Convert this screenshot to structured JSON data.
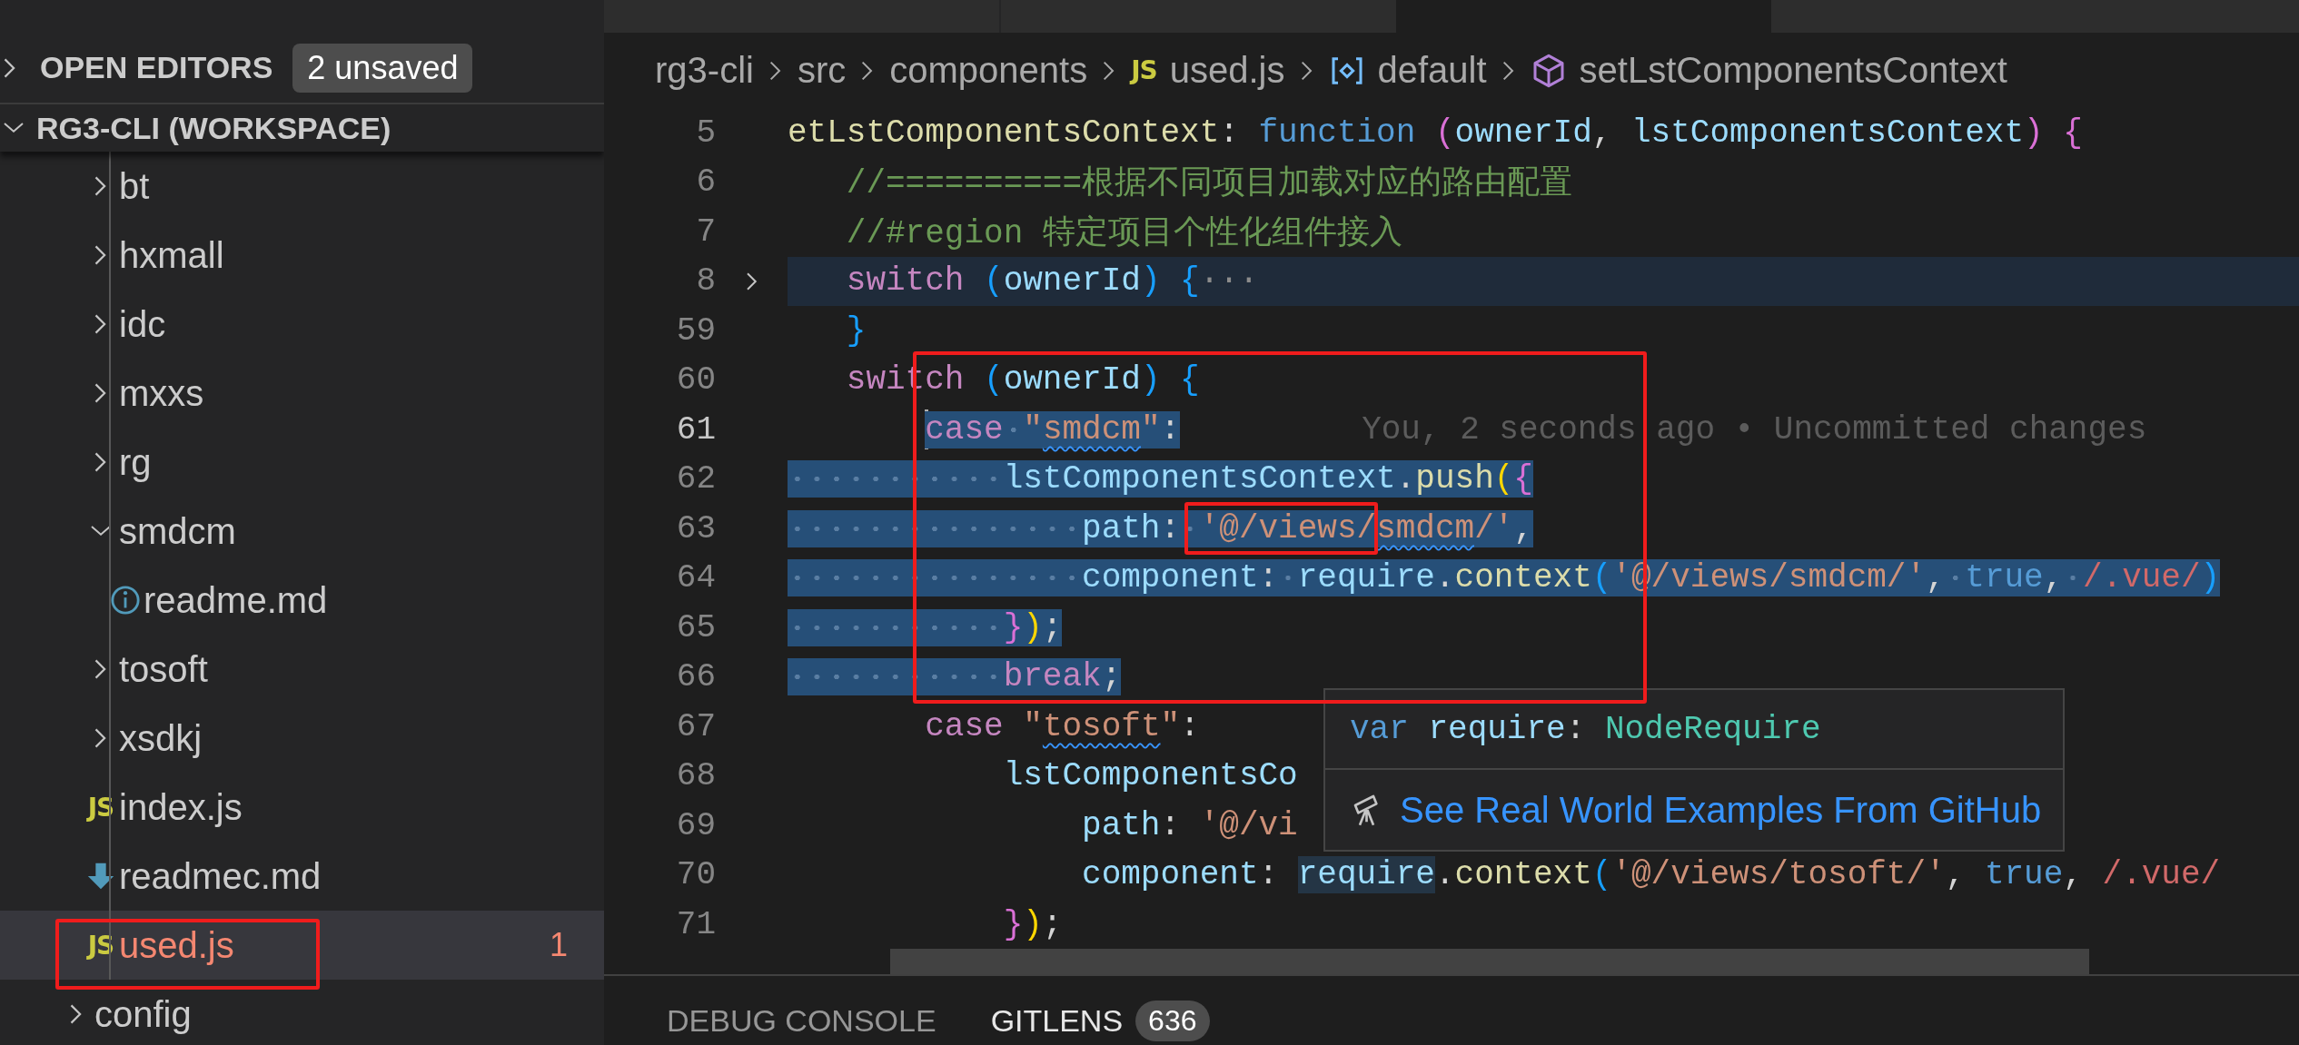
{
  "sidebar": {
    "open_editors": {
      "title": "OPEN EDITORS",
      "badge": "2 unsaved",
      "expanded": false
    },
    "workspace": {
      "title": "RG3-CLI (WORKSPACE)",
      "expanded": true
    },
    "items": [
      {
        "label": "bt",
        "kind": "folder",
        "expanded": false,
        "selected": false,
        "modified": false
      },
      {
        "label": "hxmall",
        "kind": "folder",
        "expanded": false,
        "selected": false,
        "modified": false
      },
      {
        "label": "idc",
        "kind": "folder",
        "expanded": false,
        "selected": false,
        "modified": false
      },
      {
        "label": "mxxs",
        "kind": "folder",
        "expanded": false,
        "selected": false,
        "modified": false
      },
      {
        "label": "rg",
        "kind": "folder",
        "expanded": false,
        "selected": false,
        "modified": false
      },
      {
        "label": "smdcm",
        "kind": "folder",
        "expanded": true,
        "selected": false,
        "modified": false,
        "children": [
          {
            "label": "readme.md",
            "kind": "info",
            "selected": false,
            "modified": false
          }
        ]
      },
      {
        "label": "tosoft",
        "kind": "folder",
        "expanded": false,
        "selected": false,
        "modified": false
      },
      {
        "label": "xsdkj",
        "kind": "folder",
        "expanded": false,
        "selected": false,
        "modified": false
      },
      {
        "label": "index.js",
        "kind": "js",
        "icon_label": "JS",
        "selected": false,
        "modified": false
      },
      {
        "label": "readmec.md",
        "kind": "download",
        "selected": false,
        "modified": false
      },
      {
        "label": "used.js",
        "kind": "js",
        "icon_label": "JS",
        "selected": true,
        "modified": true,
        "problems": "1"
      }
    ],
    "parent_items": [
      {
        "label": "config",
        "kind": "folder",
        "expanded": false,
        "selected": false,
        "modified": false
      }
    ]
  },
  "breadcrumb": [
    {
      "label": "rg3-cli",
      "kind": "plain"
    },
    {
      "label": "src",
      "kind": "plain"
    },
    {
      "label": "components",
      "kind": "plain"
    },
    {
      "label": "used.js",
      "kind": "js",
      "icon_label": "JS"
    },
    {
      "label": "default",
      "kind": "module"
    },
    {
      "label": "setLstComponentsContext",
      "kind": "method"
    }
  ],
  "editor": {
    "lines": [
      {
        "number": "5",
        "selected": false,
        "current": false,
        "folded": false,
        "tokens": [
          {
            "text": "etLstComponentsContext",
            "kind": "fn"
          },
          {
            "text": ": ",
            "kind": "punc"
          },
          {
            "text": "function",
            "kind": "storage"
          },
          {
            "text": " (",
            "kind": "b2"
          },
          {
            "text": "ownerId",
            "kind": "id"
          },
          {
            "text": ", ",
            "kind": "punc"
          },
          {
            "text": "lstComponentsContext",
            "kind": "id"
          },
          {
            "text": ")",
            "kind": "b2"
          },
          {
            "text": " {",
            "kind": "b2"
          }
        ]
      },
      {
        "number": "6",
        "selected": false,
        "current": false,
        "folded": false,
        "tokens": [
          {
            "text": "   //==========根据不同项目加载对应的路由配置",
            "kind": "com"
          }
        ]
      },
      {
        "number": "7",
        "selected": false,
        "current": false,
        "folded": false,
        "tokens": [
          {
            "text": "   //#region 特定项目个性化组件接入",
            "kind": "com"
          }
        ]
      },
      {
        "number": "8",
        "selected": false,
        "current": false,
        "folded": true,
        "tokens": [
          {
            "text": "   switch",
            "kind": "kw"
          },
          {
            "text": " (",
            "kind": "b1"
          },
          {
            "text": "ownerId",
            "kind": "id"
          },
          {
            "text": ")",
            "kind": "b1"
          },
          {
            "text": " {",
            "kind": "b1"
          },
          {
            "text": "···",
            "kind": "fold"
          }
        ]
      },
      {
        "number": "59",
        "selected": false,
        "current": false,
        "folded": false,
        "tokens": [
          {
            "text": "   }",
            "kind": "b1"
          }
        ]
      },
      {
        "number": "60",
        "selected": false,
        "current": false,
        "folded": false,
        "tokens": [
          {
            "text": "   switch",
            "kind": "kw"
          },
          {
            "text": " (",
            "kind": "b1"
          },
          {
            "text": "ownerId",
            "kind": "id"
          },
          {
            "text": ")",
            "kind": "b1"
          },
          {
            "text": " {",
            "kind": "b1"
          }
        ]
      },
      {
        "number": "61",
        "selected": true,
        "current": true,
        "folded": false,
        "blame": "You, 2 seconds ago • Uncommitted changes",
        "tokens": [
          {
            "text": "       case",
            "kind": "kw"
          },
          {
            "text": " \"",
            "kind": "str"
          },
          {
            "text": "smdcm",
            "kind": "spell"
          },
          {
            "text": "\"",
            "kind": "str"
          },
          {
            "text": ":",
            "kind": "punc"
          }
        ]
      },
      {
        "number": "62",
        "selected": true,
        "current": false,
        "folded": false,
        "tokens": [
          {
            "text": "           lstComponentsContext",
            "kind": "id"
          },
          {
            "text": ".",
            "kind": "punc"
          },
          {
            "text": "push",
            "kind": "fn"
          },
          {
            "text": "(",
            "kind": "b3"
          },
          {
            "text": "{",
            "kind": "b2"
          }
        ]
      },
      {
        "number": "63",
        "selected": true,
        "current": false,
        "folded": false,
        "tokens": [
          {
            "text": "               path",
            "kind": "id"
          },
          {
            "text": ":",
            "kind": "punc"
          },
          {
            "text": " '@/views/",
            "kind": "str"
          },
          {
            "text": "smdcm",
            "kind": "spell"
          },
          {
            "text": "/'",
            "kind": "str"
          },
          {
            "text": ",",
            "kind": "punc"
          }
        ]
      },
      {
        "number": "64",
        "selected": true,
        "current": false,
        "folded": false,
        "tokens": [
          {
            "text": "               component",
            "kind": "id"
          },
          {
            "text": ":",
            "kind": "punc"
          },
          {
            "text": " require",
            "kind": "id"
          },
          {
            "text": ".",
            "kind": "punc"
          },
          {
            "text": "context",
            "kind": "fn"
          },
          {
            "text": "(",
            "kind": "b1"
          },
          {
            "text": "'@/views/smdcm/'",
            "kind": "str"
          },
          {
            "text": ",",
            "kind": "punc"
          },
          {
            "text": " true",
            "kind": "storage"
          },
          {
            "text": ",",
            "kind": "punc"
          },
          {
            "text": " /.vue/",
            "kind": "rx"
          },
          {
            "text": ")",
            "kind": "b1"
          }
        ]
      },
      {
        "number": "65",
        "selected": true,
        "current": false,
        "folded": false,
        "tokens": [
          {
            "text": "           }",
            "kind": "b2"
          },
          {
            "text": ")",
            "kind": "b3"
          },
          {
            "text": ";",
            "kind": "punc"
          }
        ]
      },
      {
        "number": "66",
        "selected": true,
        "current": false,
        "folded": false,
        "tokens": [
          {
            "text": "           break",
            "kind": "kw"
          },
          {
            "text": ";",
            "kind": "punc"
          }
        ]
      },
      {
        "number": "67",
        "selected": false,
        "current": false,
        "folded": false,
        "tokens": [
          {
            "text": "       case",
            "kind": "kw"
          },
          {
            "text": " \"",
            "kind": "str"
          },
          {
            "text": "tosoft",
            "kind": "spell"
          },
          {
            "text": "\"",
            "kind": "str"
          },
          {
            "text": ":",
            "kind": "punc"
          }
        ]
      },
      {
        "number": "68",
        "selected": false,
        "current": false,
        "folded": false,
        "tokens": [
          {
            "text": "           lstComponentsCo",
            "kind": "id"
          }
        ]
      },
      {
        "number": "69",
        "selected": false,
        "current": false,
        "folded": false,
        "tokens": [
          {
            "text": "               path",
            "kind": "id"
          },
          {
            "text": ": ",
            "kind": "punc"
          },
          {
            "text": "'@/vi",
            "kind": "str"
          }
        ]
      },
      {
        "number": "70",
        "selected": false,
        "current": false,
        "folded": false,
        "tokens": [
          {
            "text": "               component",
            "kind": "id"
          },
          {
            "text": ": ",
            "kind": "punc"
          },
          {
            "text": "require",
            "kind": "hl"
          },
          {
            "text": ".",
            "kind": "punc"
          },
          {
            "text": "context",
            "kind": "fn"
          },
          {
            "text": "(",
            "kind": "b1"
          },
          {
            "text": "'@/views/tosoft/'",
            "kind": "str"
          },
          {
            "text": ", ",
            "kind": "punc"
          },
          {
            "text": "true",
            "kind": "storage"
          },
          {
            "text": ", ",
            "kind": "punc"
          },
          {
            "text": "/.vue/",
            "kind": "rx"
          }
        ]
      },
      {
        "number": "71",
        "selected": false,
        "current": false,
        "folded": false,
        "tokens": [
          {
            "text": "           }",
            "kind": "b2"
          },
          {
            "text": ")",
            "kind": "b3"
          },
          {
            "text": ";",
            "kind": "punc"
          }
        ]
      }
    ],
    "hover": {
      "signature": [
        {
          "text": "var",
          "kind": "storage"
        },
        {
          "text": " require",
          "kind": "id"
        },
        {
          "text": ": ",
          "kind": "punc"
        },
        {
          "text": "NodeRequire",
          "kind": "type"
        }
      ],
      "link": "See Real World Examples From GitHub"
    }
  },
  "panel": {
    "tabs": [
      {
        "label": "DEBUG CONSOLE",
        "selected": false
      },
      {
        "label": "GITLENS",
        "selected": true,
        "badge": "636"
      }
    ]
  }
}
